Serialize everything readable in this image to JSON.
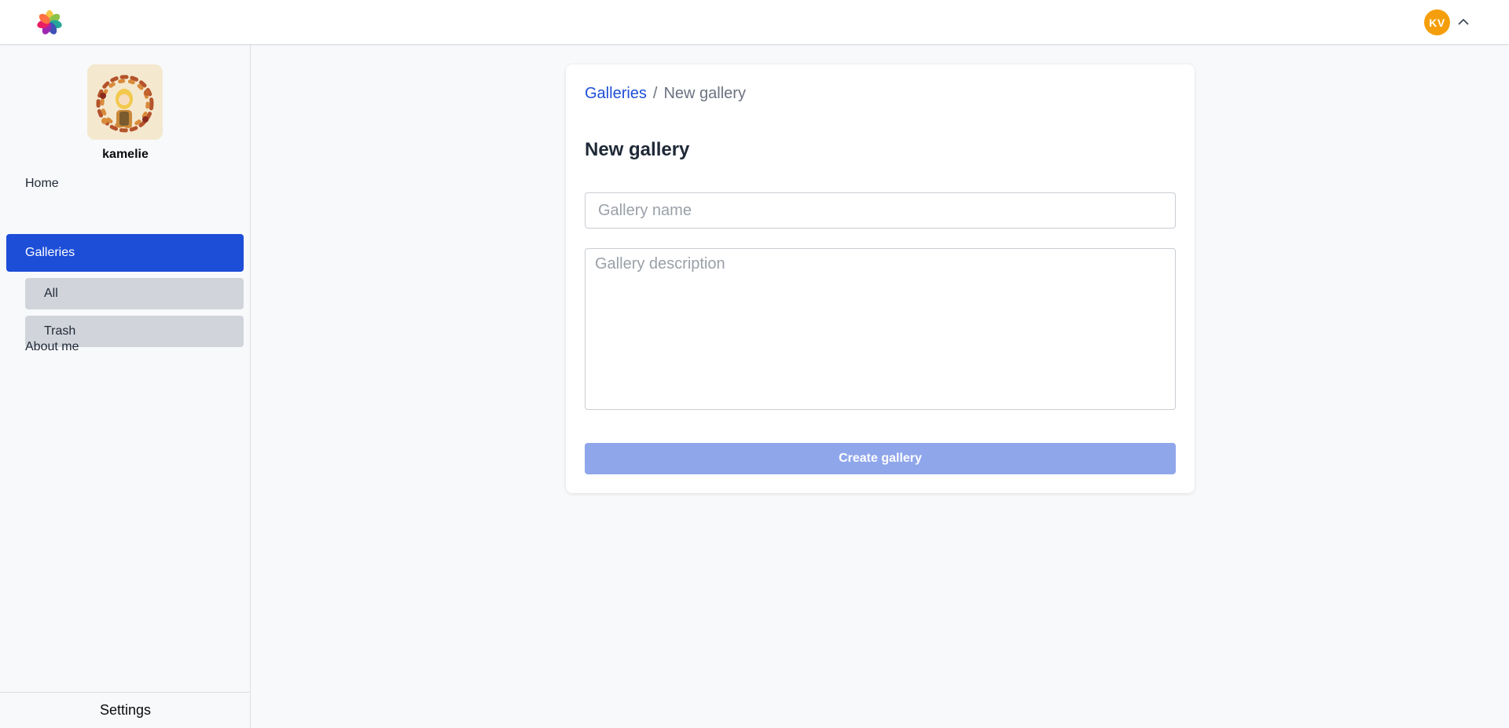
{
  "header": {
    "user_initials": "KV",
    "colors": {
      "avatar_bg": "#f59e0b"
    }
  },
  "sidebar": {
    "profile_name": "kamelie",
    "items": [
      {
        "label": "Home"
      },
      {
        "label": "Galleries",
        "active": true
      },
      {
        "label": "About me"
      }
    ],
    "sub_items": [
      {
        "label": "All"
      },
      {
        "label": "Trash"
      }
    ],
    "settings_label": "Settings",
    "colors": {
      "active_bg": "#1d4ed8",
      "sub_bg": "#d1d5db"
    }
  },
  "main": {
    "breadcrumb": {
      "link": "Galleries",
      "separator": "/",
      "current": "New gallery"
    },
    "title": "New gallery",
    "form": {
      "name_placeholder": "Gallery name",
      "name_value": "",
      "description_placeholder": "Gallery description",
      "description_value": "",
      "submit_label": "Create gallery"
    },
    "colors": {
      "link": "#1d4ed8",
      "button_disabled": "#8fa6eb"
    }
  }
}
